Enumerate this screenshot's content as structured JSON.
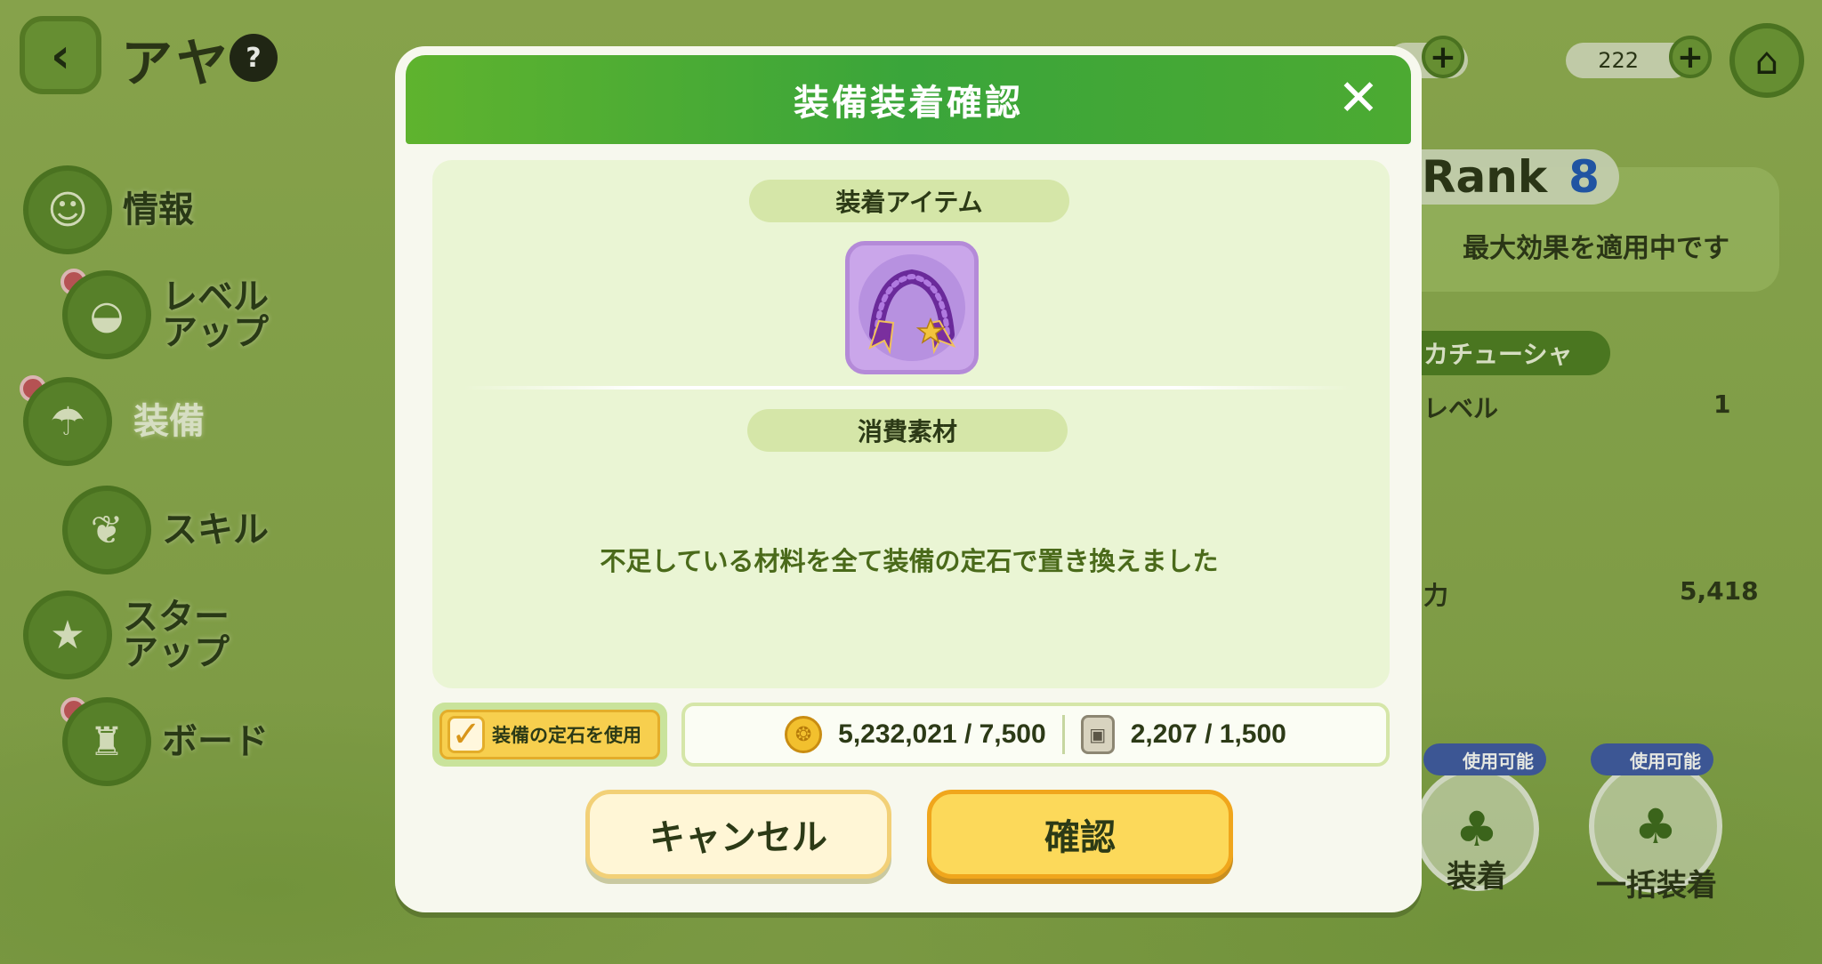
{
  "character": {
    "name": "アヤ"
  },
  "menu": [
    {
      "label": "情報"
    },
    {
      "label": "レベル\nアップ"
    },
    {
      "label": "装備"
    },
    {
      "label": "スキル"
    },
    {
      "label": "スター\nアップ"
    },
    {
      "label": "ボード"
    }
  ],
  "topbar": {
    "resource_count": "222"
  },
  "right_panel": {
    "rank_label": "Rank",
    "rank_value": "8",
    "max_effect": "最大効果を適用中です",
    "item_name": "カチューシャ",
    "level_label": "レベル",
    "level_value": "1",
    "power_label": "力",
    "power_value": "5,418",
    "equip_badge": "使用可能",
    "equip_label": "装着",
    "bulk_badge": "使用可能",
    "bulk_label": "一括装着"
  },
  "modal": {
    "title": "装備装着確認",
    "equip_item_section": "装着アイテム",
    "consume_section": "消費素材",
    "notice": "不足している材料を全て装備の定石で置き換えました",
    "use_gem_label": "装備の定石を使用",
    "use_gem_checked": true,
    "gold_cost": "5,232,021 / 7,500",
    "gem_cost": "2,207 / 1,500",
    "cancel_label": "キャンセル",
    "confirm_label": "確認",
    "item_slot_color": "#caa6ea"
  }
}
